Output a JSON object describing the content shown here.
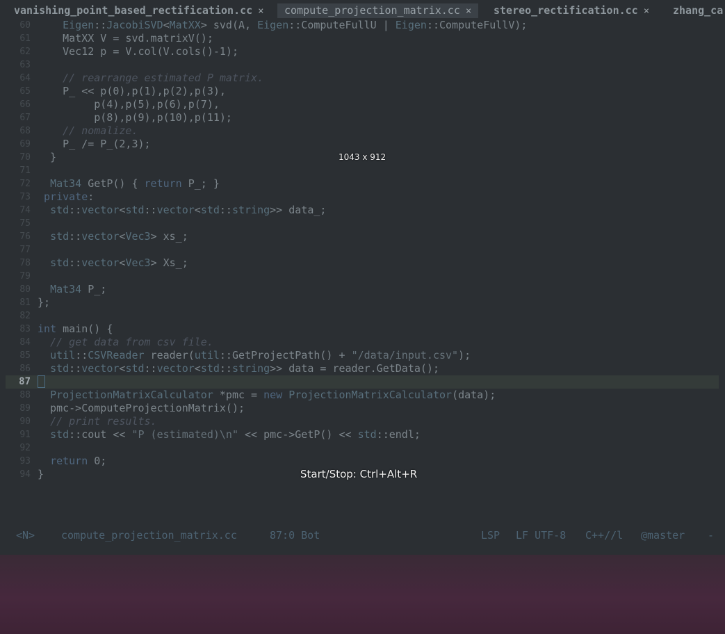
{
  "tabs": [
    {
      "name": "vanishing_point_based_rectification.cc",
      "close": "×",
      "active": false
    },
    {
      "name": "compute_projection_matrix.cc",
      "close": "×",
      "active": true
    },
    {
      "name": "stereo_rectification.cc",
      "close": "×",
      "active": false
    },
    {
      "name": "zhang_ca",
      "close": "",
      "active": false
    }
  ],
  "lines": [
    {
      "n": "60",
      "code": "    <span class='ty'>Eigen</span>::<span class='ty'>JacobiSVD</span>&lt;<span class='ty'>MatXX</span>&gt; svd(A, <span class='ty'>Eigen</span>::ComputeFullU | <span class='ty'>Eigen</span>::ComputeFullV);"
    },
    {
      "n": "61",
      "code": "    MatXX V = svd.matrixV();"
    },
    {
      "n": "62",
      "code": "    Vec12 p = V.col(V.cols()-1);"
    },
    {
      "n": "63",
      "code": ""
    },
    {
      "n": "64",
      "code": "    <span class='cm'>// rearrange estimated P matrix.</span>"
    },
    {
      "n": "65",
      "code": "    P_ &lt;&lt; p(0),p(1),p(2),p(3),"
    },
    {
      "n": "66",
      "code": "         p(4),p(5),p(6),p(7),"
    },
    {
      "n": "67",
      "code": "         p(8),p(9),p(10),p(11);"
    },
    {
      "n": "68",
      "code": "    <span class='cm'>// nomalize.</span>"
    },
    {
      "n": "69",
      "code": "    P_ /= P_(2,3);"
    },
    {
      "n": "70",
      "code": "  }"
    },
    {
      "n": "71",
      "code": ""
    },
    {
      "n": "72",
      "code": "  <span class='ty'>Mat34</span> GetP() { <span class='kw'>return</span> P_; }"
    },
    {
      "n": "73",
      "code": " <span class='kw'>private</span>:"
    },
    {
      "n": "74",
      "code": "  <span class='ty'>std</span>::<span class='ty'>vector</span>&lt;<span class='ty'>std</span>::<span class='ty'>vector</span>&lt;<span class='ty'>std</span>::<span class='ty'>string</span>&gt;&gt; data_;"
    },
    {
      "n": "75",
      "code": ""
    },
    {
      "n": "76",
      "code": "  <span class='ty'>std</span>::<span class='ty'>vector</span>&lt;<span class='ty'>Vec3</span>&gt; xs_;"
    },
    {
      "n": "77",
      "code": ""
    },
    {
      "n": "78",
      "code": "  <span class='ty'>std</span>::<span class='ty'>vector</span>&lt;<span class='ty'>Vec3</span>&gt; Xs_;"
    },
    {
      "n": "79",
      "code": ""
    },
    {
      "n": "80",
      "code": "  <span class='ty'>Mat34</span> P_;"
    },
    {
      "n": "81",
      "code": "};"
    },
    {
      "n": "82",
      "code": ""
    },
    {
      "n": "83",
      "code": "<span class='kw'>int</span> main() {"
    },
    {
      "n": "84",
      "code": "  <span class='cm'>// get data from csv file.</span>"
    },
    {
      "n": "85",
      "code": "  <span class='ty'>util</span>::<span class='ty'>CSVReader</span> reader(<span class='ty'>util</span>::GetProjectPath() + <span class='st'>\"/data/input.csv\"</span>);"
    },
    {
      "n": "86",
      "code": "  <span class='ty'>std</span>::<span class='ty'>vector</span>&lt;<span class='ty'>std</span>::<span class='ty'>vector</span>&lt;<span class='ty'>std</span>::<span class='ty'>string</span>&gt;&gt; data = reader.GetData();"
    },
    {
      "n": "87",
      "code": "",
      "current": true
    },
    {
      "n": "88",
      "code": "  <span class='ty'>ProjectionMatrixCalculator</span> *pmc = <span class='kw'>new</span> <span class='ty'>ProjectionMatrixCalculator</span>(data);"
    },
    {
      "n": "89",
      "code": "  pmc-&gt;ComputeProjectionMatrix();"
    },
    {
      "n": "90",
      "code": "  <span class='cm'>// print results.</span>"
    },
    {
      "n": "91",
      "code": "  <span class='ty'>std</span>::cout &lt;&lt; <span class='st'>\"P (estimated)\\n\"</span> &lt;&lt; pmc-&gt;GetP() &lt;&lt; <span class='ty'>std</span>::endl;"
    },
    {
      "n": "92",
      "code": ""
    },
    {
      "n": "93",
      "code": "  <span class='kw'>return</span> 0;"
    },
    {
      "n": "94",
      "code": "}"
    }
  ],
  "status": {
    "mode": "<N>",
    "file": "compute_projection_matrix.cc",
    "position": "87:0 Bot",
    "lsp": "LSP",
    "encoding": "LF UTF-8",
    "filetype": "C++//l",
    "branch": "@master",
    "tail": "-"
  },
  "overlay": {
    "dimensions": "1043 x 912",
    "recorder_hint": "Start/Stop: Ctrl+Alt+R"
  },
  "colors": {
    "editor_bg": "#2b2f33",
    "current_line_bg": "#343b39",
    "desktop": "#46283d"
  }
}
